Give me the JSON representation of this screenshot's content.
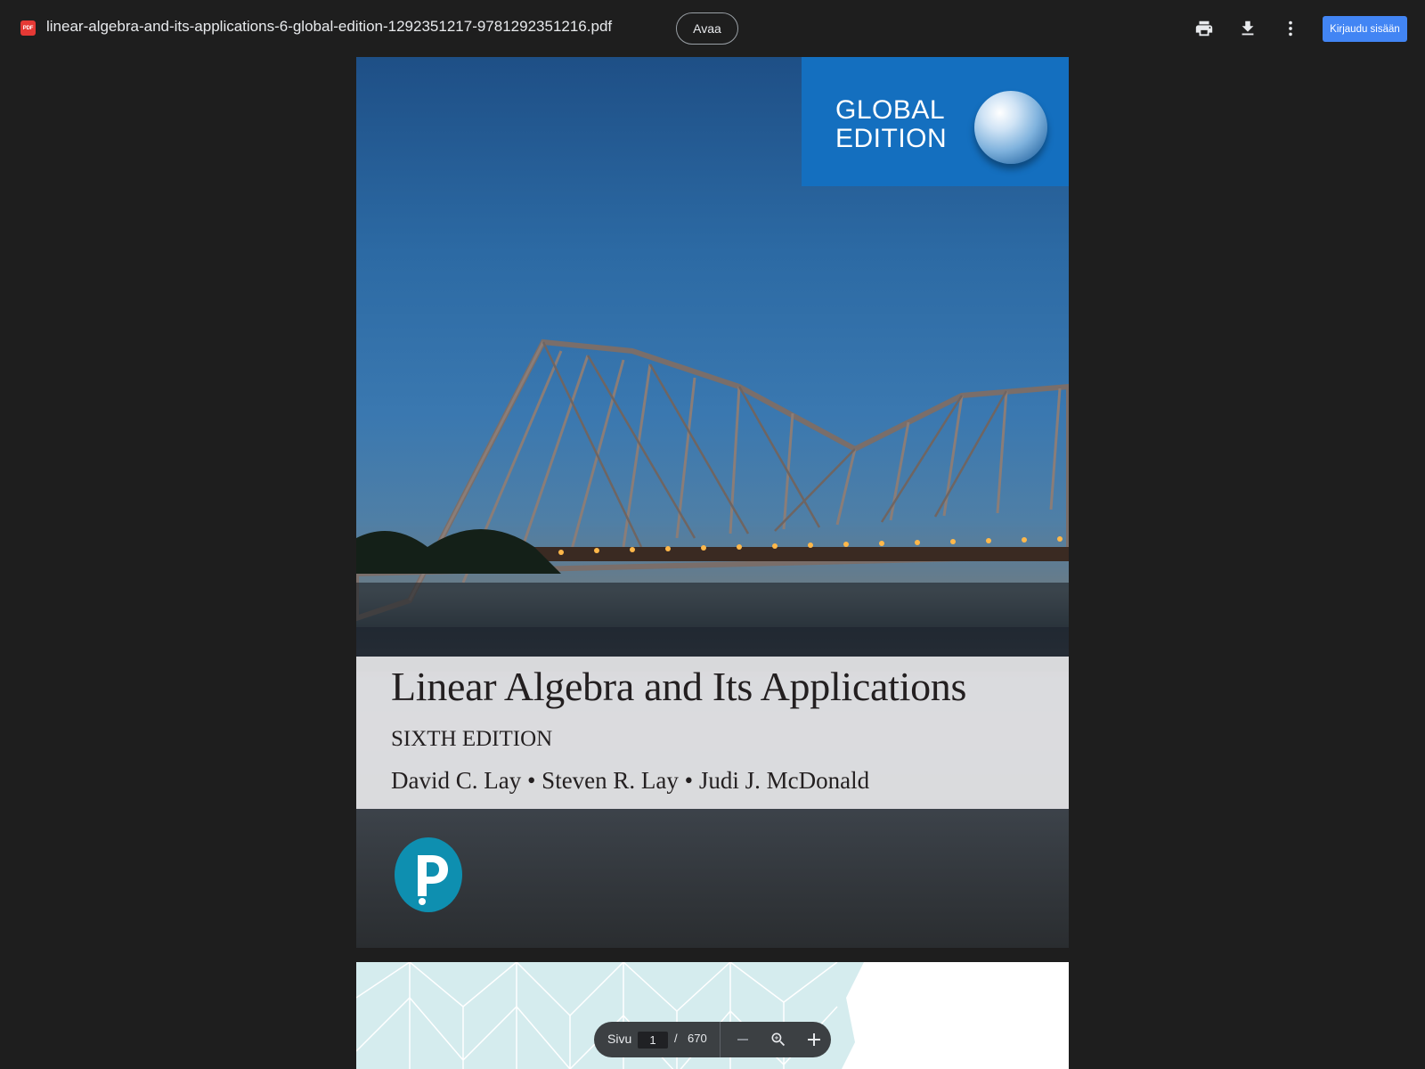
{
  "header": {
    "file_badge": "PDF",
    "filename": "linear-algebra-and-its-applications-6-global-edition-1292351217-9781292351216.pdf",
    "open_label": "Avaa",
    "print_icon": "print-icon",
    "download_icon": "download-icon",
    "more_icon": "more-vert-icon",
    "signin_label": "Kirjaudu sisään"
  },
  "cover": {
    "badge_line1": "GLOBAL",
    "badge_line2": "EDITION",
    "title": "Linear Algebra and Its Applications",
    "edition": "SIXTH EDITION",
    "authors": "David C. Lay • Steven R. Lay • Judi J. McDonald",
    "publisher_logo": "pearson-logo"
  },
  "pager": {
    "label": "Sivu",
    "current_page": "1",
    "separator": "/",
    "total_pages": "670",
    "zoom_out_icon": "minus-icon",
    "zoom_icon": "zoom-in-icon",
    "zoom_in_icon": "plus-icon"
  },
  "colors": {
    "background": "#1e1e1e",
    "signin_button": "#4285f4",
    "global_band": "#146fbf",
    "pearson_teal": "#0e8fb0"
  }
}
